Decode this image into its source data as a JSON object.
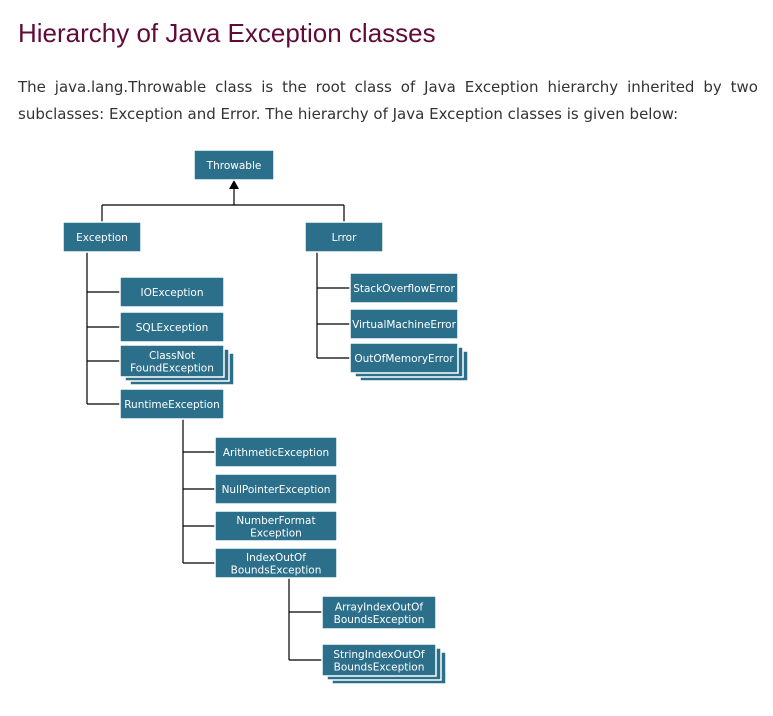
{
  "page": {
    "title": "Hierarchy of Java Exception classes",
    "intro": "The java.lang.Throwable class is the root class of Java Exception hierarchy inherited by two subclasses: Exception and Error. The hierarchy of Java Exception classes is given below:"
  },
  "colors": {
    "title": "#610b38",
    "box": "#2c6f8a",
    "text": "#333333"
  },
  "diagram": {
    "throwable": [
      "Throwable"
    ],
    "exception": [
      "Exception"
    ],
    "error": [
      "Lrror"
    ],
    "ioexception": [
      "IOException"
    ],
    "sqlexception": [
      "SQLException"
    ],
    "classnotfound": [
      "ClassNot",
      "FoundException"
    ],
    "runtime": [
      "RuntimeException"
    ],
    "stackoverflow": [
      "StackOverflowError"
    ],
    "virtualmachine": [
      "VirtualMachineError"
    ],
    "outofmemory": [
      "OutOfMemoryError"
    ],
    "arithmetic": [
      "ArithmeticException"
    ],
    "nullpointer": [
      "NullPointerException"
    ],
    "numberformat": [
      "NumberFormat",
      "Exception"
    ],
    "indexoutofbounds": [
      "IndexOutOf",
      "BoundsException"
    ],
    "arrayindex": [
      "ArrayIndexOutOf",
      "BoundsException"
    ],
    "stringindex": [
      "StringIndexOutOf",
      "BoundsException"
    ]
  }
}
